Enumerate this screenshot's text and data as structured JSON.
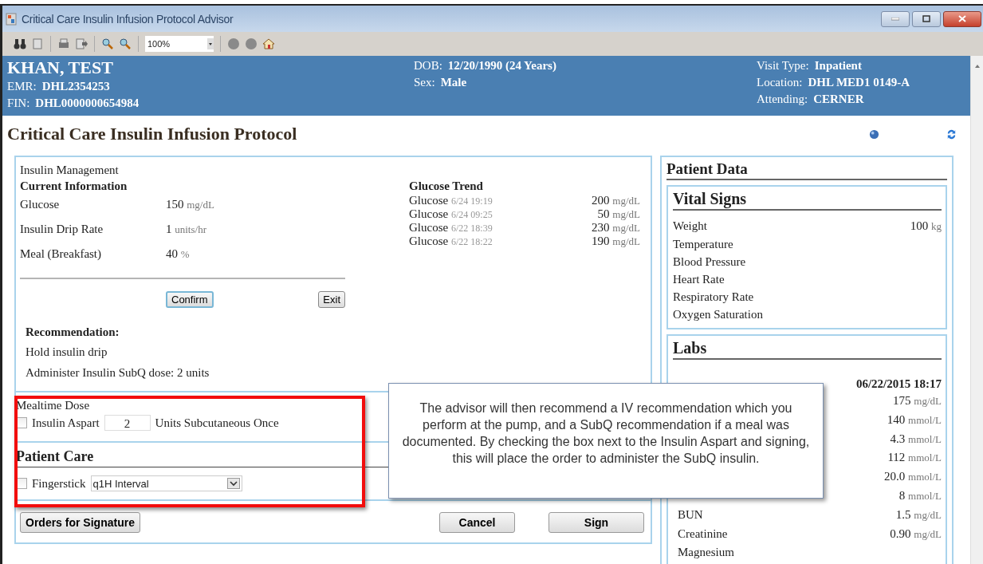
{
  "window": {
    "title": "Critical Care Insulin Infusion Protocol Advisor"
  },
  "toolbar": {
    "zoom": "100%"
  },
  "patient": {
    "name": "KHAN, TEST",
    "left_fields": [
      {
        "label": "EMR:",
        "value": "DHL2354253"
      },
      {
        "label": "FIN:",
        "value": "DHL0000000654984"
      }
    ],
    "middle_fields": [
      {
        "label": "DOB:",
        "value": "12/20/1990 (24 Years)"
      },
      {
        "label": "Sex:",
        "value": "Male"
      }
    ],
    "right_fields": [
      {
        "label": "Visit Type:",
        "value": "Inpatient"
      },
      {
        "label": "Location:",
        "value": "DHL MED1 0149-A"
      },
      {
        "label": "Attending:",
        "value": "CERNER"
      }
    ]
  },
  "page_title": "Critical Care Insulin Infusion Protocol",
  "insulin_management": {
    "title": "Insulin Management",
    "subtitle": "Current Information",
    "current_info": [
      {
        "label": "Glucose",
        "value": "150",
        "unit": "mg/dL"
      },
      {
        "label": "Insulin Drip Rate",
        "value": "1",
        "unit": "units/hr"
      },
      {
        "label": "Meal (Breakfast)",
        "value": "40",
        "unit": "%"
      }
    ],
    "glucose_trend": {
      "title": "Glucose Trend",
      "readings": [
        {
          "label": "Glucose",
          "time": "6/24 19:19",
          "value": "200",
          "unit": "mg/dL"
        },
        {
          "label": "Glucose",
          "time": "6/24 09:25",
          "value": "50",
          "unit": "mg/dL"
        },
        {
          "label": "Glucose",
          "time": "6/22 18:39",
          "value": "230",
          "unit": "mg/dL"
        },
        {
          "label": "Glucose",
          "time": "6/22 18:22",
          "value": "190",
          "unit": "mg/dL"
        }
      ]
    },
    "buttons": [
      {
        "label": "Confirm",
        "focused": true
      },
      {
        "label": "Exit",
        "focused": false
      }
    ],
    "recommendation": {
      "title": "Recommendation:",
      "lines": [
        "Hold insulin drip",
        "Administer Insulin SubQ dose: 2 units"
      ]
    }
  },
  "mealtime_dose": {
    "title": "Mealtime Dose",
    "checked": false,
    "drug": "Insulin Aspart",
    "dose": "2",
    "instructions": "Units Subcutaneous Once"
  },
  "patient_care": {
    "title": "Patient Care",
    "checked": false,
    "label": "Fingerstick",
    "interval": "q1H Interval"
  },
  "footer": {
    "left_buttons": [
      "Orders for Signature"
    ],
    "right_buttons": [
      "Cancel",
      "Sign"
    ]
  },
  "patient_data": {
    "title": "Patient Data",
    "vital_signs": {
      "title": "Vital Signs",
      "rows": [
        {
          "label": "Weight",
          "value": "100",
          "unit": "kg"
        },
        {
          "label": "Temperature"
        },
        {
          "label": "Blood Pressure"
        },
        {
          "label": "Heart Rate"
        },
        {
          "label": "Respiratory Rate"
        },
        {
          "label": "Oxygen Saturation"
        }
      ]
    },
    "labs": {
      "title": "Labs",
      "datetime": "06/22/2015 18:17",
      "rows": [
        {
          "value": "175",
          "unit": "mg/dL"
        },
        {
          "value": "140",
          "unit": "mmol/L"
        },
        {
          "value": "4.3",
          "unit": "mmol/L"
        },
        {
          "value": "112",
          "unit": "mmol/L"
        },
        {
          "value": "20.0",
          "unit": "mmol/L"
        },
        {
          "value": "8",
          "unit": "mmol/L"
        },
        {
          "label": "BUN",
          "value": "1.5",
          "unit": "mg/dL"
        },
        {
          "label": "Creatinine",
          "value": "0.90",
          "unit": "mg/dL"
        },
        {
          "label": "Magnesium"
        }
      ]
    }
  },
  "callout": {
    "text": "The advisor will then recommend a IV recommendation which you perform at the pump, and a SubQ recommendation if a meal was documented. By checking the box next to the Insulin Aspart and signing, this will place the order to administer the SubQ insulin."
  }
}
